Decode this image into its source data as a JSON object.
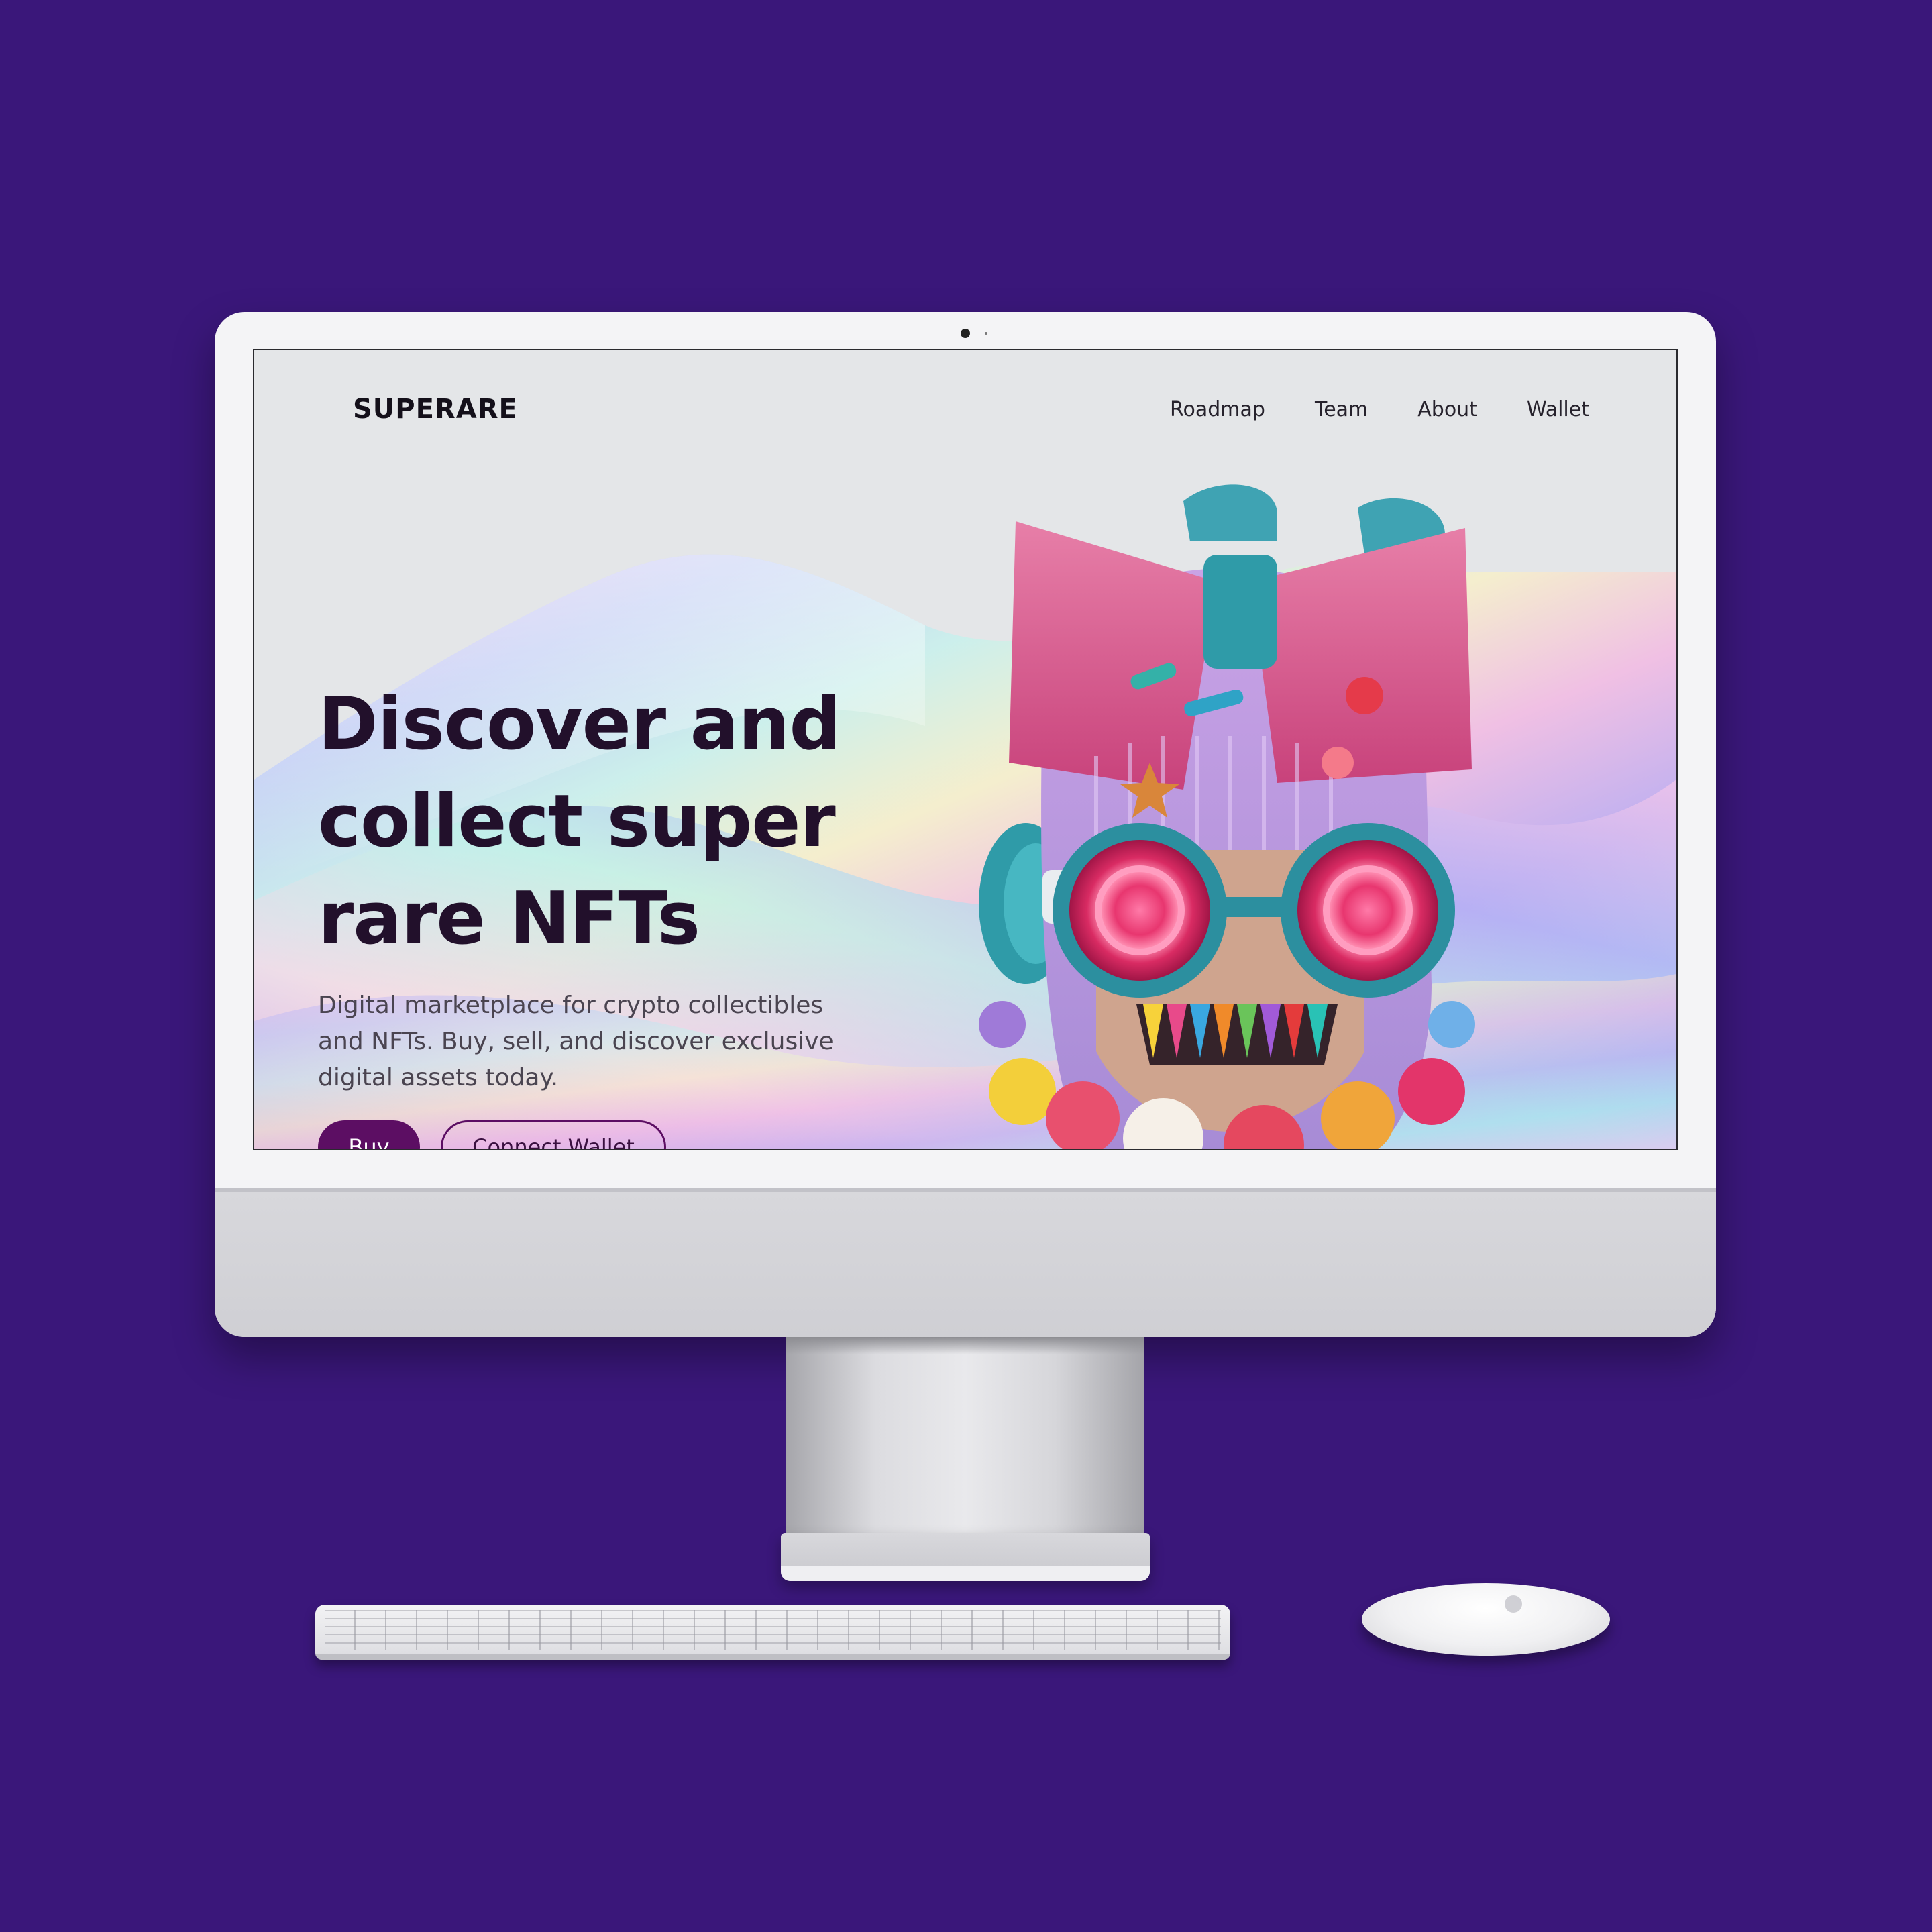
{
  "site": {
    "logo": "SUPERARE",
    "nav": [
      "Roadmap",
      "Team",
      "About",
      "Wallet"
    ]
  },
  "hero": {
    "title_lines": [
      "Discover and",
      "collect super",
      "rare NFTs"
    ],
    "subtitle_lines": [
      "Digital marketplace for crypto collectibles",
      "and NFTs. Buy, sell, and discover exclusive",
      "digital assets today."
    ],
    "buy_label": "Buy",
    "connect_label": "Connect Wallet"
  },
  "colors": {
    "background": "#3a177a",
    "screen_bg": "#e4e6e8",
    "accent": "#5c0e63",
    "heading": "#22102b"
  },
  "icons": [
    "camera-icon",
    "apple-logo-icon"
  ]
}
